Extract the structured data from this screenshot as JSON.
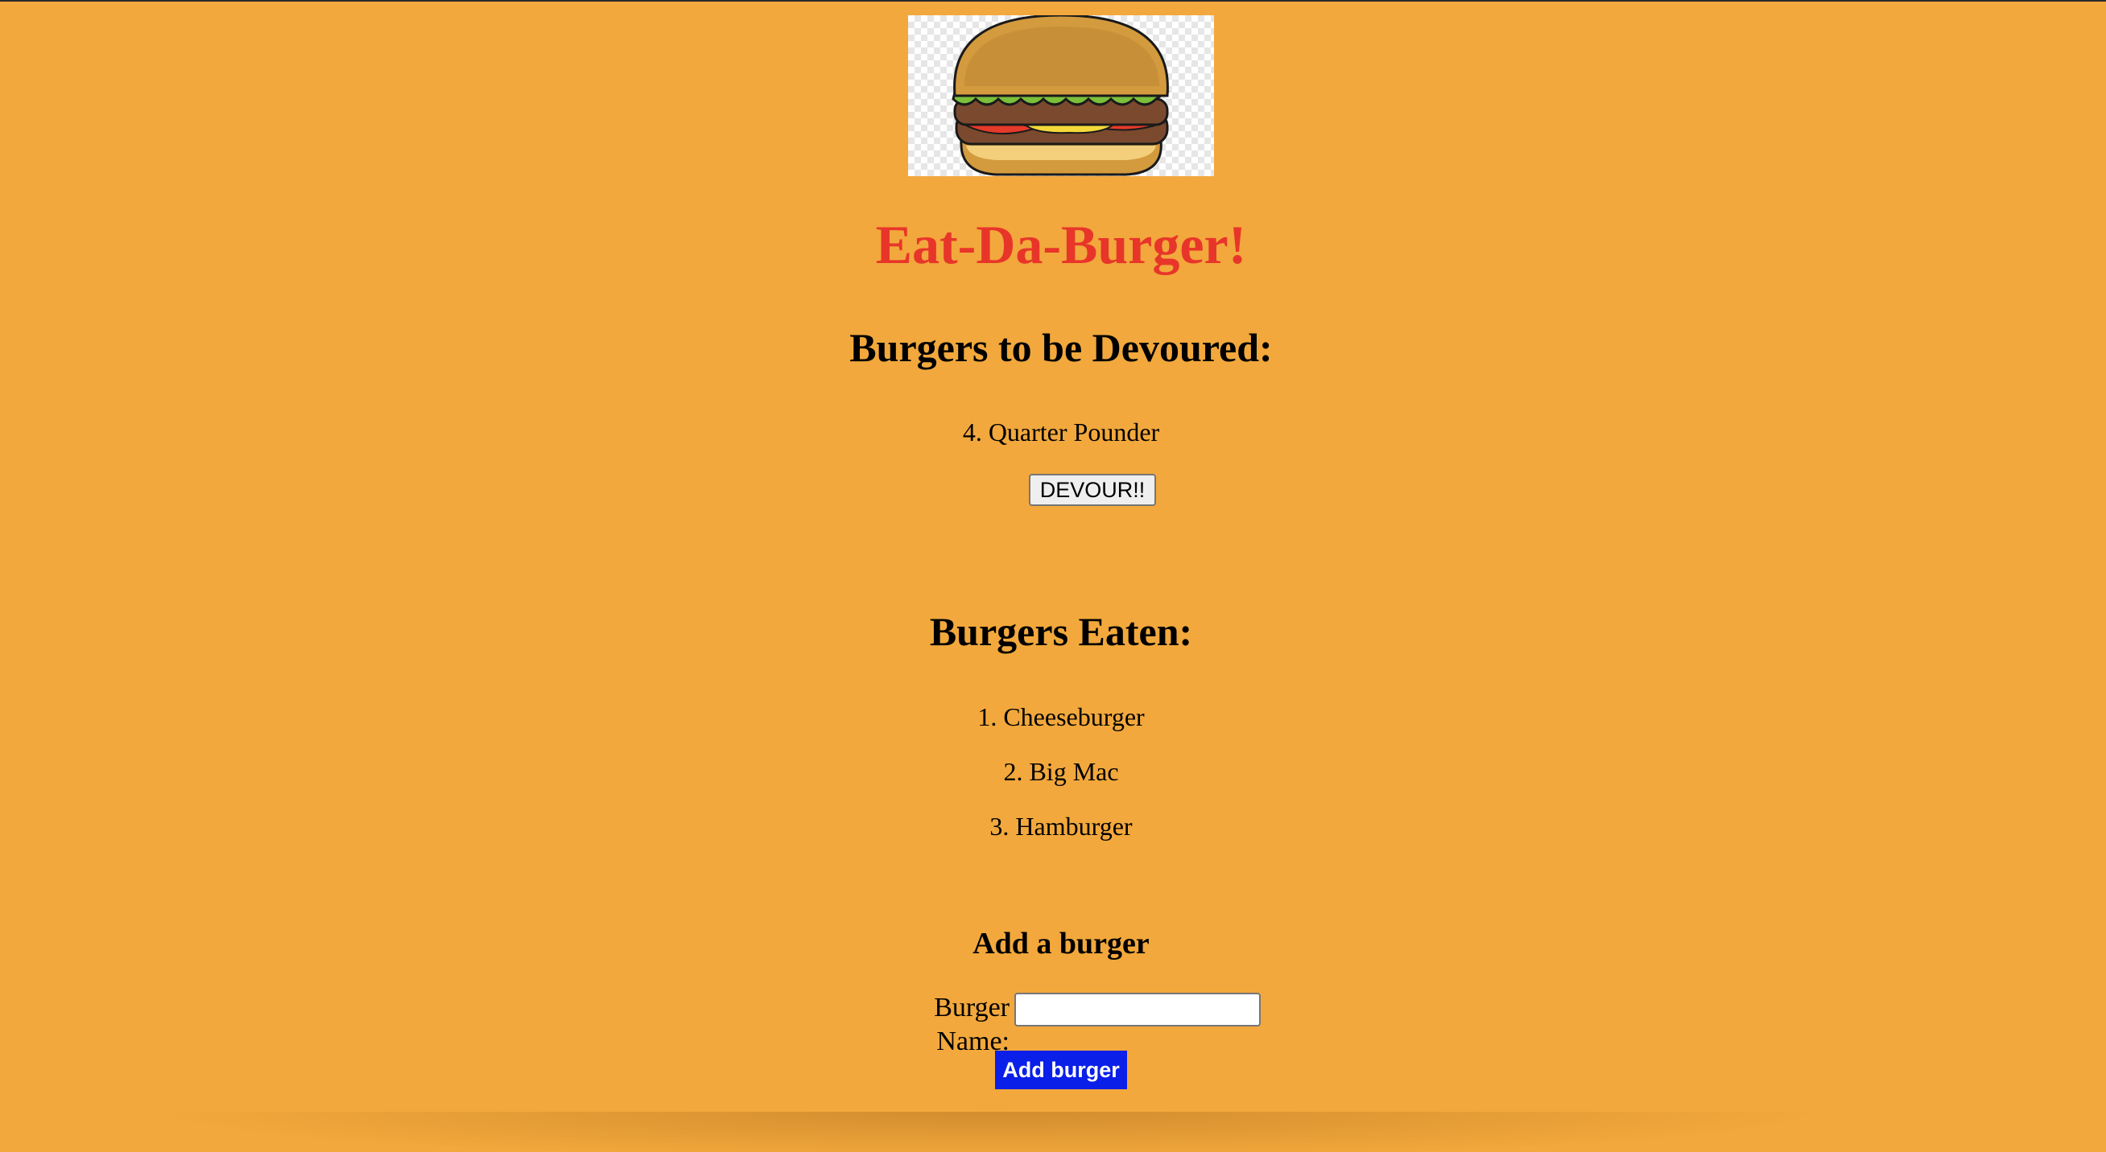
{
  "theme": {
    "background": "#f2a83c",
    "title_color": "#e8352a",
    "add_button_bg": "#0a1fe8"
  },
  "logo": {
    "icon": "burger-icon"
  },
  "title": "Eat-Da-Burger!",
  "to_devour": {
    "heading": "Burgers to be Devoured:",
    "items": [
      {
        "label": "4. Quarter Pounder",
        "button": "DEVOUR!!"
      }
    ]
  },
  "eaten": {
    "heading": "Burgers Eaten:",
    "items": [
      "1. Cheeseburger",
      "2. Big Mac",
      "3. Hamburger"
    ]
  },
  "add_form": {
    "heading": "Add a burger",
    "label": "Burger Name:",
    "input_value": "",
    "submit": "Add burger"
  }
}
